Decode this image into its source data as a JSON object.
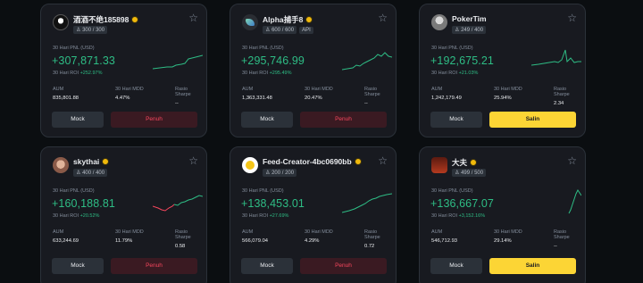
{
  "labels": {
    "pnl": "30 Hari PNL (USD)",
    "roi": "30 Hari ROI",
    "aum": "AUM",
    "mdd": "30 Hari MDD",
    "sharpe": "Rasio Sharpe",
    "mock": "Mock"
  },
  "cards": [
    {
      "name": "酒酒不绝185898",
      "slots": "300 / 300",
      "api": "",
      "pnl": "+307,871.33",
      "roi": "+252.97%",
      "aum": "835,801.88",
      "mdd": "4.47%",
      "sharpe": "--",
      "action": "Penuh",
      "avatar_icon": "avatar-icon"
    },
    {
      "name": "Alpha捕手8",
      "slots": "600 / 600",
      "api": "API",
      "pnl": "+295,746.99",
      "roi": "+295.49%",
      "aum": "1,363,331.48",
      "mdd": "20.47%",
      "sharpe": "--",
      "action": "Penuh",
      "avatar_icon": "avatar-icon"
    },
    {
      "name": "PokerTim",
      "slots": "249 / 400",
      "api": "",
      "pnl": "+192,675.21",
      "roi": "+21.03%",
      "aum": "1,242,179.49",
      "mdd": "25.94%",
      "sharpe": "2.34",
      "action": "Salin",
      "avatar_icon": "avatar-icon"
    },
    {
      "name": "skythai",
      "slots": "400 / 400",
      "api": "",
      "pnl": "+160,188.81",
      "roi": "+20.52%",
      "aum": "633,244.69",
      "mdd": "11.79%",
      "sharpe": "0.58",
      "action": "Penuh",
      "avatar_icon": "avatar-icon"
    },
    {
      "name": "Feed-Creator-4bc0690bb",
      "slots": "200 / 200",
      "api": "",
      "pnl": "+138,453.01",
      "roi": "+27.69%",
      "aum": "566,079.04",
      "mdd": "4.29%",
      "sharpe": "0.72",
      "action": "Penuh",
      "avatar_icon": "avatar-icon"
    },
    {
      "name": "大夫",
      "slots": "499 / 500",
      "api": "",
      "pnl": "+136,667.07",
      "roi": "+3,152.16%",
      "aum": "546,712.93",
      "mdd": "29.14%",
      "sharpe": "--",
      "action": "Salin",
      "avatar_icon": "avatar-icon"
    }
  ],
  "colors": {
    "positive": "#2ebd85",
    "negative": "#f6465d",
    "accent": "#fcd535",
    "card_bg": "#181a20"
  }
}
